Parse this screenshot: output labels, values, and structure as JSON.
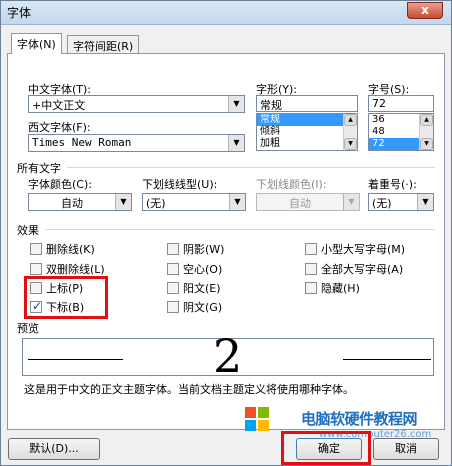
{
  "window": {
    "title": "字体",
    "close_glyph": "x"
  },
  "tabs": [
    {
      "label": "字体(N)"
    },
    {
      "label": "字符间距(R)"
    }
  ],
  "font": {
    "chinese_font_label": "中文字体(T):",
    "chinese_font_value": "+中文正文",
    "western_font_label": "西文字体(F):",
    "western_font_value": "Times New Roman",
    "style_label": "字形(Y):",
    "style_value": "常规",
    "style_options": [
      "常规",
      "倾斜",
      "加粗"
    ],
    "size_label": "字号(S):",
    "size_value": "72",
    "size_options": [
      "36",
      "48",
      "72"
    ]
  },
  "all_text": {
    "section_label": "所有文字",
    "font_color_label": "字体颜色(C):",
    "font_color_value": "自动",
    "underline_type_label": "下划线线型(U):",
    "underline_type_value": "(无)",
    "underline_color_label": "下划线颜色(I):",
    "underline_color_value": "自动",
    "emphasis_label": "着重号(·):",
    "emphasis_value": "(无)"
  },
  "effects": {
    "section_label": "效果",
    "strikethrough": "删除线(K)",
    "double_strikethrough": "双删除线(L)",
    "superscript": "上标(P)",
    "subscript": "下标(B)",
    "shadow": "阴影(W)",
    "outline": "空心(O)",
    "emboss": "阳文(E)",
    "engrave": "阴文(G)",
    "small_caps": "小型大写字母(M)",
    "all_caps": "全部大写字母(A)",
    "hidden": "隐藏(H)"
  },
  "preview": {
    "section_label": "预览",
    "sample": "2",
    "description": "这是用于中文的正文主题字体。当前文档主题定义将使用哪种字体。"
  },
  "buttons": {
    "default": "默认(D)...",
    "ok": "确定",
    "cancel": "取消"
  },
  "watermark": {
    "title": "电脑软硬件教程网",
    "url": "www.computer26.com"
  },
  "colors": {
    "highlight": "#e01010",
    "selection": "#3399ff"
  }
}
